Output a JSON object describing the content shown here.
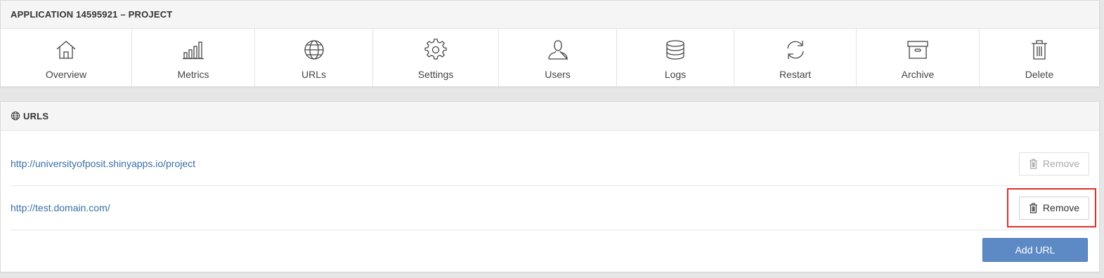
{
  "app_header": {
    "title": "APPLICATION 14595921 – PROJECT"
  },
  "toolbar": {
    "items": [
      {
        "label": "Overview",
        "icon": "home-icon"
      },
      {
        "label": "Metrics",
        "icon": "bar-chart-icon"
      },
      {
        "label": "URLs",
        "icon": "globe-icon"
      },
      {
        "label": "Settings",
        "icon": "gear-icon"
      },
      {
        "label": "Users",
        "icon": "user-icon"
      },
      {
        "label": "Logs",
        "icon": "database-icon"
      },
      {
        "label": "Restart",
        "icon": "refresh-icon"
      },
      {
        "label": "Archive",
        "icon": "archive-icon"
      },
      {
        "label": "Delete",
        "icon": "trash-icon"
      }
    ]
  },
  "urls_panel": {
    "title": "URLS",
    "icon": "globe-icon",
    "rows": [
      {
        "url": "http://universityofposit.shinyapps.io/project",
        "remove_label": "Remove",
        "remove_enabled": false
      },
      {
        "url": "http://test.domain.com/",
        "remove_label": "Remove",
        "remove_enabled": true
      }
    ],
    "add_label": "Add URL"
  },
  "colors": {
    "link": "#3a6fa6",
    "primary_button": "#5d8ac4",
    "highlight": "#e0302a"
  }
}
